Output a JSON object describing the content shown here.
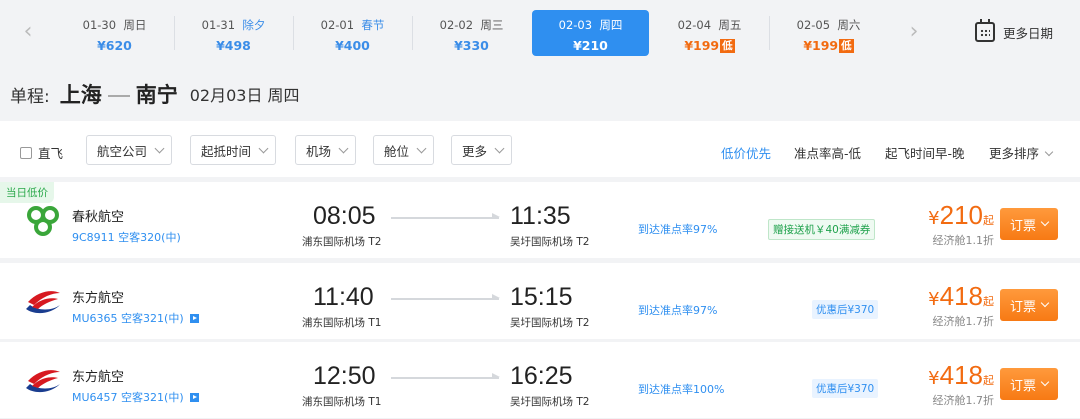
{
  "dates": [
    {
      "date": "01-30",
      "day": "周日",
      "holiday": "",
      "price": "¥620",
      "low": "",
      "active": false
    },
    {
      "date": "01-31",
      "day": "",
      "holiday": "除夕",
      "price": "¥498",
      "low": "",
      "active": false
    },
    {
      "date": "02-01",
      "day": "",
      "holiday": "春节",
      "price": "¥400",
      "low": "",
      "active": false
    },
    {
      "date": "02-02",
      "day": "周三",
      "holiday": "",
      "price": "¥330",
      "low": "",
      "active": false
    },
    {
      "date": "02-03",
      "day": "周四",
      "holiday": "",
      "price": "¥210",
      "low": "",
      "active": true
    },
    {
      "date": "02-04",
      "day": "周五",
      "holiday": "",
      "price": "¥199",
      "low": "低",
      "active": false
    },
    {
      "date": "02-05",
      "day": "周六",
      "holiday": "",
      "price": "¥199",
      "low": "低",
      "active": false
    }
  ],
  "more_dates": "更多日期",
  "route": {
    "label": "单程:",
    "from": "上海",
    "to": "南宁",
    "date": "02月03日 周四"
  },
  "filters": {
    "direct": "直飞",
    "dropdowns": [
      "航空公司",
      "起抵时间",
      "机场",
      "舱位",
      "更多"
    ],
    "sorts": [
      "低价优先",
      "准点率高-低",
      "起飞时间早-晚",
      "更多排序"
    ]
  },
  "flights": [
    {
      "tag": "当日低价",
      "airline": "春秋航空",
      "flight_no": "9C8911 空客320(中)",
      "has_video": false,
      "dep_time": "08:05",
      "dep_airport": "浦东国际机场 T2",
      "arr_time": "11:35",
      "arr_airport": "吴圩国际机场 T2",
      "punctuality": "到达准点率97%",
      "promo": "赠接送机￥40满减券",
      "promo_style": "green",
      "currency": "¥",
      "price": "210",
      "qi": "起",
      "cabin": "经济舱1.1折",
      "book": "订票",
      "logo": "spring-airlines-logo"
    },
    {
      "tag": "",
      "airline": "东方航空",
      "flight_no": "MU6365 空客321(中)",
      "has_video": true,
      "dep_time": "11:40",
      "dep_airport": "浦东国际机场 T1",
      "arr_time": "15:15",
      "arr_airport": "吴圩国际机场 T2",
      "punctuality": "到达准点率97%",
      "promo": "优惠后¥370",
      "promo_style": "blue",
      "currency": "¥",
      "price": "418",
      "qi": "起",
      "cabin": "经济舱1.7折",
      "book": "订票",
      "logo": "china-eastern-logo"
    },
    {
      "tag": "",
      "airline": "东方航空",
      "flight_no": "MU6457 空客321(中)",
      "has_video": true,
      "dep_time": "12:50",
      "dep_airport": "浦东国际机场 T1",
      "arr_time": "16:25",
      "arr_airport": "吴圩国际机场 T2",
      "punctuality": "到达准点率100%",
      "promo": "优惠后¥370",
      "promo_style": "blue",
      "currency": "¥",
      "price": "418",
      "qi": "起",
      "cabin": "经济舱1.7折",
      "book": "订票",
      "logo": "china-eastern-logo"
    }
  ],
  "colors": {
    "accent": "#2f8ff0",
    "price": "#f26b11",
    "book": "#f77a14",
    "green": "#2aa84a"
  }
}
